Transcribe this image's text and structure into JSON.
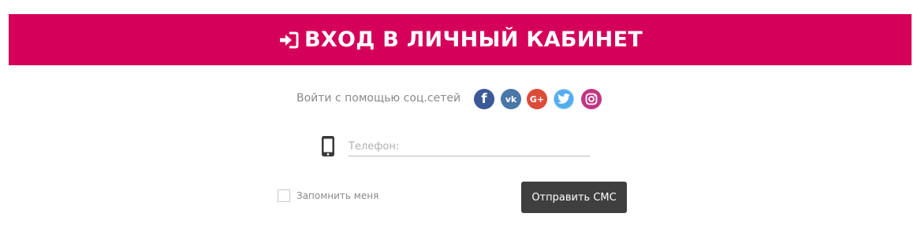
{
  "banner": {
    "icon": "sign-in-icon",
    "title": "ВХОД В ЛИЧНЫЙ КАБИНЕТ",
    "background_color": "#d4005a"
  },
  "social": {
    "label": "Войти с помощью соц.сетей",
    "networks": [
      {
        "icon": "facebook-icon",
        "glyph": "f",
        "color": "#3b5998"
      },
      {
        "icon": "vk-icon",
        "glyph": "vk",
        "color": "#4a76a8"
      },
      {
        "icon": "google-plus-icon",
        "glyph": "G+",
        "color": "#dd4b39"
      },
      {
        "icon": "twitter-icon",
        "glyph": "",
        "color": "#55acee"
      },
      {
        "icon": "instagram-icon",
        "glyph": "",
        "color": "#c13584"
      }
    ]
  },
  "phone": {
    "icon": "mobile-phone-icon",
    "placeholder": "Телефон:",
    "value": ""
  },
  "remember": {
    "label": "Запомнить меня",
    "checked": false
  },
  "send_button": {
    "label": "Отправить СМС",
    "color": "#3f3f3f"
  }
}
